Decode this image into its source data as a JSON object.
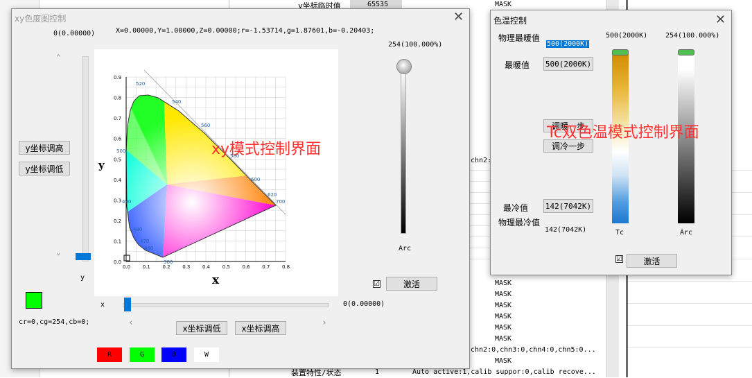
{
  "background": {
    "top_label": "y坐标临时值",
    "top_value": "65535",
    "top_mask": "MASK",
    "chn_snippet": "chn2:",
    "mask_rows": [
      "MASK",
      "MASK",
      "MASK",
      "MASK",
      "MASK",
      "MASK"
    ],
    "row_chn": "chn2:0,chn3:0,chn4:0,chn5:0...",
    "row_mask_last": "MASK",
    "bottom_label": "装置特性/状态",
    "bottom_num": "1",
    "bottom_value": "Auto active:1,calib suppor:0,calib recove..."
  },
  "xy_window": {
    "title": "xy色度图控制",
    "y_readout_top": "0(0.00000)",
    "xyz_readout": "X=0.00000,Y=1.00000,Z=0.00000;r=-1.53714,g=1.87601,b=-0.20403;",
    "arc_value": "254(100.000%)",
    "arc_label": "Arc",
    "y_up_button": "y坐标调高",
    "y_down_button": "y坐标调低",
    "y_label": "y",
    "color_readout": "cr=0,cg=254,cb=0;",
    "x_label": "x",
    "x_readout": "0(0.00000)",
    "x_down_button": "x坐标调低",
    "x_up_button": "x坐标调高",
    "activate_button": "激活",
    "activate_checked": "☑",
    "swatches": [
      {
        "label": "R",
        "color": "#ff0000",
        "text": "#000000"
      },
      {
        "label": "G",
        "color": "#00ff00",
        "text": "#000000"
      },
      {
        "label": "B",
        "color": "#0000ff",
        "text": "#000000"
      },
      {
        "label": "W",
        "color": "#ffffff",
        "text": "#000000"
      }
    ],
    "preview_color": "#00ff00",
    "overlay": "xy模式控制界面",
    "arc_level": 1.0,
    "x_level": 0.0,
    "y_level": 0.0,
    "diagram": {
      "xlabel": "x",
      "ylabel": "y",
      "x_ticks": [
        "0.0",
        "0.1",
        "0.2",
        "0.3",
        "0.4",
        "0.5",
        "0.6",
        "0.7",
        "0.8"
      ],
      "y_ticks": [
        "0.0",
        "0.1",
        "0.2",
        "0.3",
        "0.4",
        "0.5",
        "0.6",
        "0.7",
        "0.8",
        "0.9"
      ],
      "wavelengths": [
        "380",
        "460",
        "470",
        "480",
        "490",
        "500",
        "520",
        "540",
        "560",
        "580",
        "600",
        "620",
        "700"
      ]
    }
  },
  "tc_window": {
    "title": "色温控制",
    "phys_warm_label": "物理最暖值",
    "phys_warm_value": "500(2000K)",
    "warm_label": "最暖值",
    "warm_button": "500(2000K)",
    "tc_header": "500(2000K)",
    "arc_header": "254(100.000%)",
    "warmer_button": "调暖一步",
    "cooler_button": "调冷一步",
    "cold_label": "最冷值",
    "cold_button": "142(7042K)",
    "phys_cold_label": "物理最冷值",
    "phys_cold_value": "142(7042K)",
    "tc_label": "Tc",
    "arc_label": "Arc",
    "activate_button": "激活",
    "activate_checked": "☑",
    "overlay": "Tc双色温模式控制界面",
    "tc_level": 1.0,
    "arc_level": 1.0
  }
}
